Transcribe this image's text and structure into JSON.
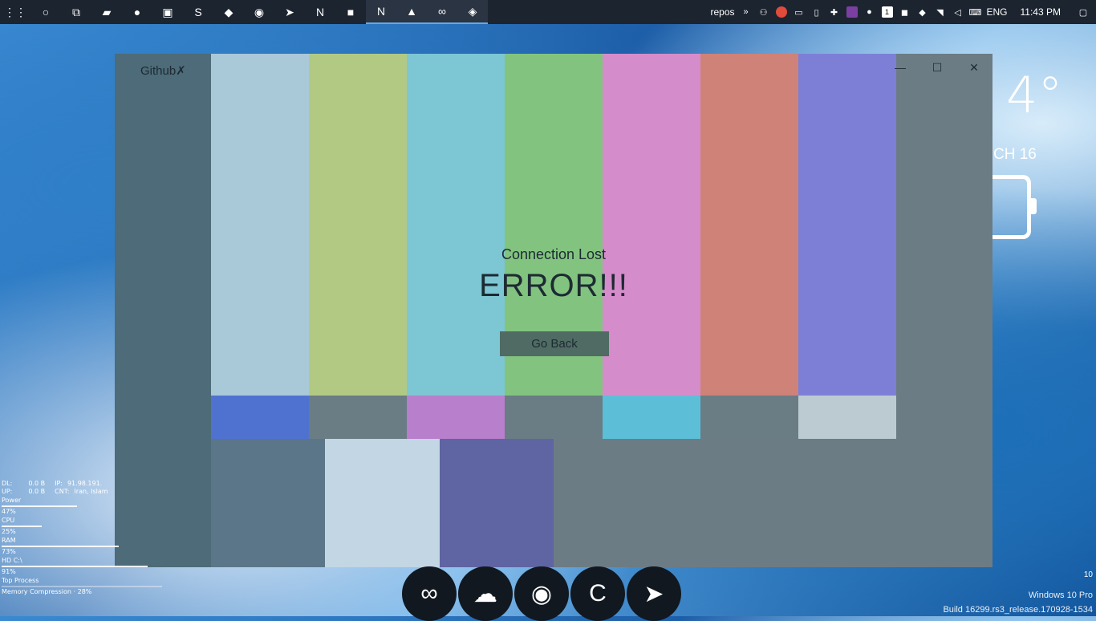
{
  "taskbar": {
    "apps": [
      {
        "name": "apps-grid-icon",
        "glyph": "⋮⋮",
        "active": false
      },
      {
        "name": "cortana-icon",
        "glyph": "○",
        "active": false
      },
      {
        "name": "task-view-icon",
        "glyph": "⧉",
        "active": false
      },
      {
        "name": "file-explorer-icon",
        "glyph": "▰",
        "active": false
      },
      {
        "name": "browser-icon",
        "glyph": "●",
        "active": false
      },
      {
        "name": "photos-icon",
        "glyph": "▣",
        "active": false
      },
      {
        "name": "sublime-icon",
        "glyph": "S",
        "active": false
      },
      {
        "name": "vscode-icon",
        "glyph": "◆",
        "active": false
      },
      {
        "name": "earth-icon",
        "glyph": "◉",
        "active": false
      },
      {
        "name": "telegram-icon",
        "glyph": "➤",
        "active": false
      },
      {
        "name": "notion-icon",
        "glyph": "N",
        "active": false
      },
      {
        "name": "sticky-notes-icon",
        "glyph": "■",
        "active": false
      },
      {
        "name": "onenote-icon",
        "glyph": "N",
        "active": true
      },
      {
        "name": "image-viewer-icon",
        "glyph": "▲",
        "active": true
      },
      {
        "name": "visual-studio-icon",
        "glyph": "∞",
        "active": true
      },
      {
        "name": "cat-app-icon",
        "glyph": "◈",
        "active": true
      }
    ],
    "repos_label": "repos",
    "language": "ENG",
    "time": "11:43 PM"
  },
  "window": {
    "title": "Github",
    "title_mark": "✗",
    "minimize": "—",
    "maximize": "☐",
    "close": "✕"
  },
  "error": {
    "subtitle": "Connection Lost",
    "title": "ERROR!!!",
    "button": "Go Back"
  },
  "colors": {
    "bars": [
      "#a9c8d8",
      "#b2c984",
      "#7cc7d3",
      "#82c47f",
      "#d58ccb",
      "#cf8278",
      "#7d7fd7"
    ],
    "row2": [
      "#4f72d0",
      "#6a7c84",
      "#b77fcc",
      "#6a7c84",
      "#5cbfd7",
      "#6a7c84",
      "#bccbd2"
    ],
    "row3": [
      "#5a7688",
      "#c2d6e4",
      "#5f64a2",
      "#6c7c84",
      "#6c7c84",
      "#6c7c84"
    ]
  },
  "weather": {
    "temp": "4°",
    "date": "CH 16"
  },
  "stats": {
    "dl_label": "DL:",
    "dl_value": "0.0 B",
    "ip_label": "IP:",
    "ip_value": "91.98.191.",
    "up_label": "UP:",
    "up_value": "0.0 B",
    "cnt_label": "CNT:",
    "cnt_value": "Iran, Islam",
    "power_label": "Power",
    "power_value": "47%",
    "power_pct": 47,
    "cpu_label": "CPU",
    "cpu_value": "25%",
    "cpu_pct": 25,
    "ram_label": "RAM",
    "ram_value": "73%",
    "ram_pct": 73,
    "hd_label": "HD C:\\",
    "hd_value": "91%",
    "hd_pct": 91,
    "top_label": "Top Process",
    "mem_label": "Memory Compression · 28%"
  },
  "dock": [
    {
      "name": "visual-studio-dock-icon",
      "glyph": "∞"
    },
    {
      "name": "onedrive-dock-icon",
      "glyph": "☁"
    },
    {
      "name": "github-dock-icon",
      "glyph": "◉"
    },
    {
      "name": "ccleaner-dock-icon",
      "glyph": "C"
    },
    {
      "name": "telegram-dock-icon",
      "glyph": "➤"
    }
  ],
  "watermark": {
    "corner_number": "10",
    "windows": "Windows 10 Pro",
    "build": "Build 16299.rs3_release.170928-1534"
  }
}
